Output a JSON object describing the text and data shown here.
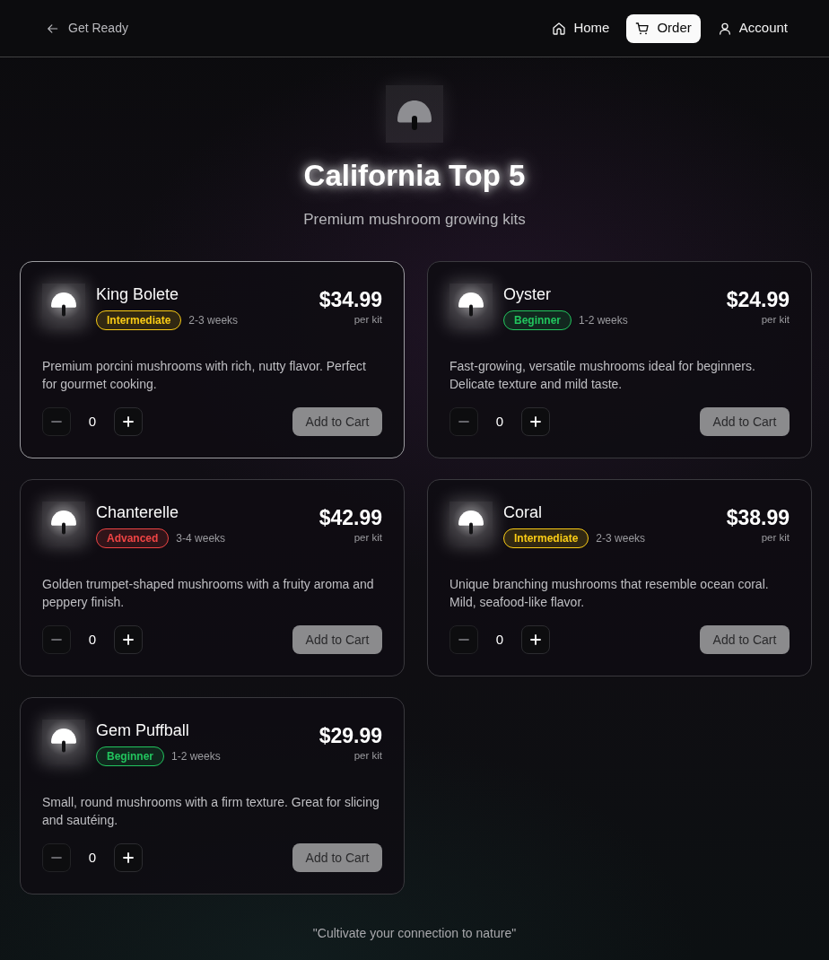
{
  "nav": {
    "back": {
      "label": "Get Ready"
    },
    "items": [
      {
        "label": "Home",
        "selected": false
      },
      {
        "label": "Order",
        "selected": true
      },
      {
        "label": "Account",
        "selected": false
      }
    ]
  },
  "hero": {
    "title": "California Top 5",
    "subtitle": "Premium mushroom growing kits"
  },
  "products": [
    {
      "name": "King Bolete",
      "difficulty": {
        "label": "Intermediate",
        "color": "#facc15"
      },
      "duration": "2-3 weeks",
      "price": "$34.99",
      "unit": "per kit",
      "description": "Premium porcini mushrooms with rich, nutty flavor. Perfect for gourmet cooking.",
      "quantity": "0",
      "decrease_disabled": true,
      "add_to_cart": {
        "label": "Add to Cart",
        "disabled": true
      },
      "selected": true
    },
    {
      "name": "Oyster",
      "difficulty": {
        "label": "Beginner",
        "color": "#22c55e"
      },
      "duration": "1-2 weeks",
      "price": "$24.99",
      "unit": "per kit",
      "description": "Fast-growing, versatile mushrooms ideal for beginners. Delicate texture and mild taste.",
      "quantity": "0",
      "decrease_disabled": true,
      "add_to_cart": {
        "label": "Add to Cart",
        "disabled": true
      },
      "selected": false
    },
    {
      "name": "Chanterelle",
      "difficulty": {
        "label": "Advanced",
        "color": "#ef4444"
      },
      "duration": "3-4 weeks",
      "price": "$42.99",
      "unit": "per kit",
      "description": "Golden trumpet-shaped mushrooms with a fruity aroma and peppery finish.",
      "quantity": "0",
      "decrease_disabled": true,
      "add_to_cart": {
        "label": "Add to Cart",
        "disabled": true
      },
      "selected": false
    },
    {
      "name": "Coral",
      "difficulty": {
        "label": "Intermediate",
        "color": "#facc15"
      },
      "duration": "2-3 weeks",
      "price": "$38.99",
      "unit": "per kit",
      "description": "Unique branching mushrooms that resemble ocean coral. Mild, seafood-like flavor.",
      "quantity": "0",
      "decrease_disabled": true,
      "add_to_cart": {
        "label": "Add to Cart",
        "disabled": true
      },
      "selected": false
    },
    {
      "name": "Gem Puffball",
      "difficulty": {
        "label": "Beginner",
        "color": "#22c55e"
      },
      "duration": "1-2 weeks",
      "price": "$29.99",
      "unit": "per kit",
      "description": "Small, round mushrooms with a firm texture. Great for slicing and sautéing.",
      "quantity": "0",
      "decrease_disabled": true,
      "add_to_cart": {
        "label": "Add to Cart",
        "disabled": true
      },
      "selected": false
    }
  ],
  "footer": {
    "quote": "\"Cultivate your connection to nature\""
  }
}
